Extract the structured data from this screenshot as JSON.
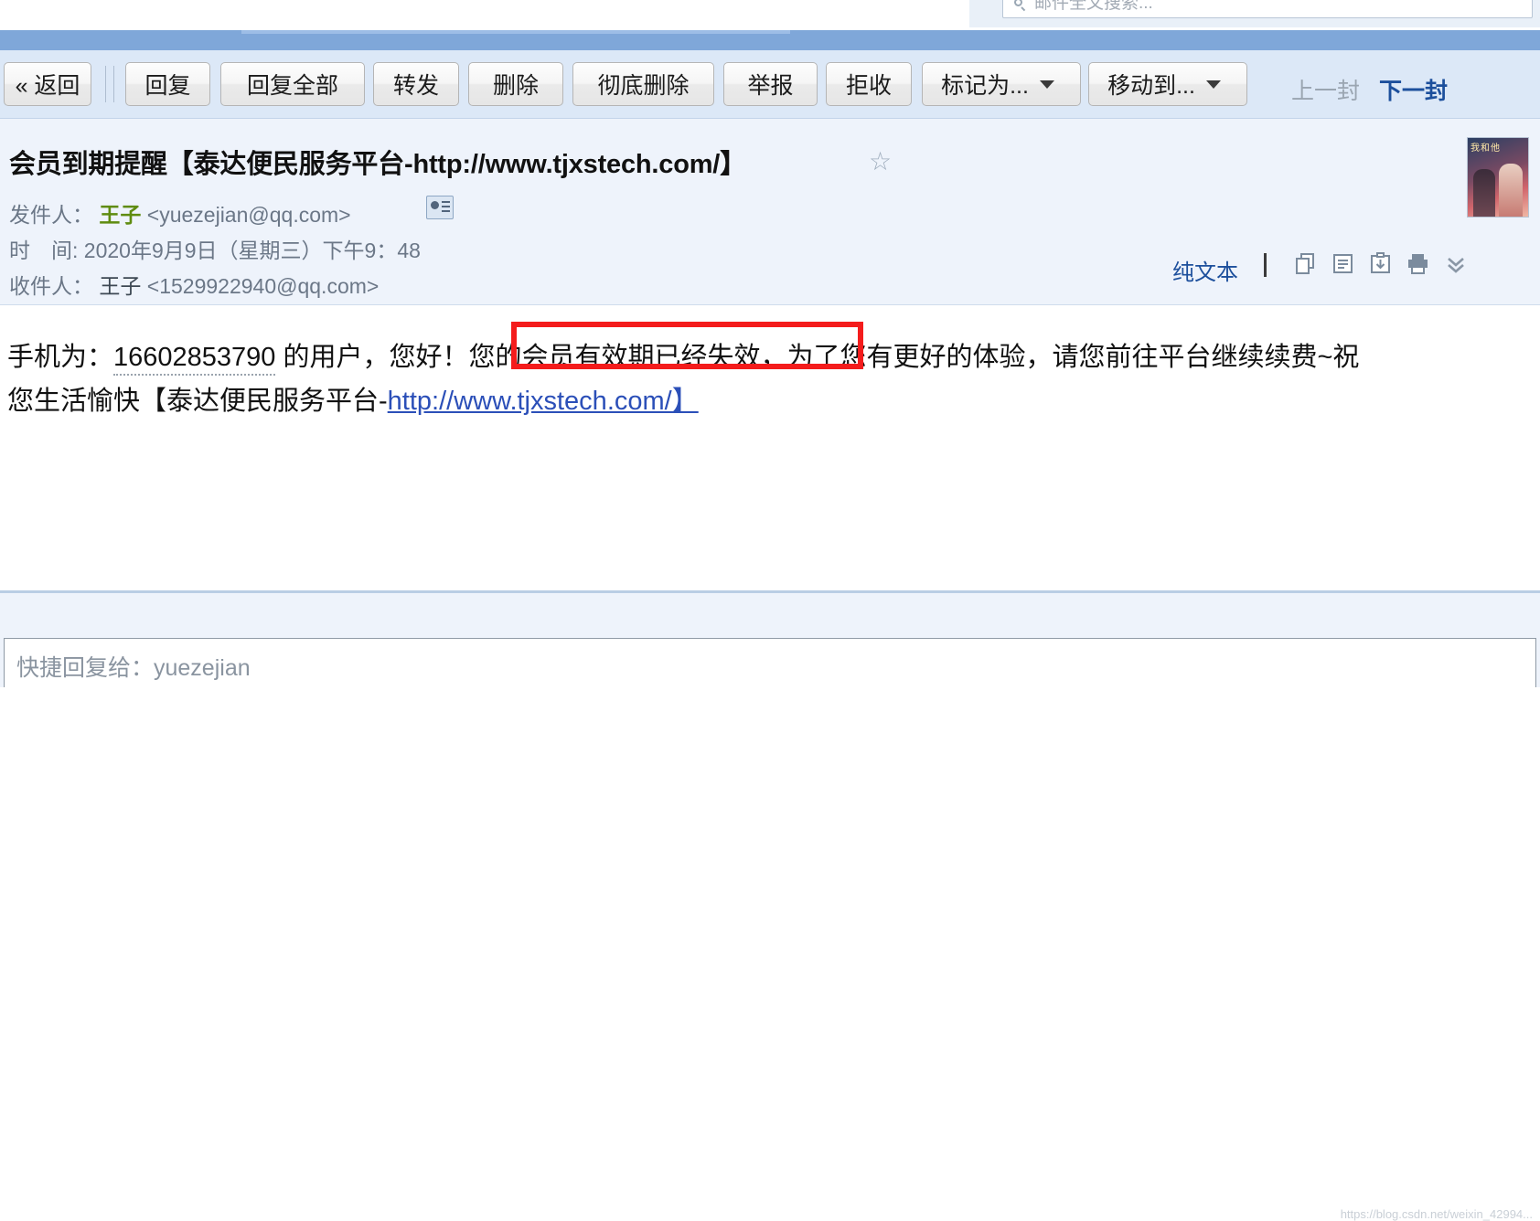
{
  "search": {
    "placeholder": "邮件全文搜索...",
    "icon": "search-icon"
  },
  "toolbar": {
    "back": "« 返回",
    "buttons": [
      {
        "label": "回复",
        "caret": false
      },
      {
        "label": "回复全部",
        "caret": false
      },
      {
        "label": "转发",
        "caret": false
      },
      {
        "label": "删除",
        "caret": false
      },
      {
        "label": "彻底删除",
        "caret": false
      },
      {
        "label": "举报",
        "caret": false
      },
      {
        "label": "拒收",
        "caret": false
      },
      {
        "label": "标记为...",
        "caret": true
      },
      {
        "label": "移动到...",
        "caret": true
      }
    ],
    "prev": "上一封",
    "next": "下一封"
  },
  "mail": {
    "subject": "会员到期提醒【泰达便民服务平台-http://www.tjxstech.com/】",
    "star_icon": "star-outline-icon",
    "from_label": "发件人：",
    "from_name": "王子",
    "from_address": "<yuezejian@qq.com>",
    "contact_icon": "contact-card-icon",
    "time_label": "时　间:",
    "time_value": "2020年9月9日（星期三）下午9：48",
    "to_label": "收件人：",
    "to_name": "王子",
    "to_address": "<1529922940@qq.com>",
    "view_mode": "纯文本",
    "tool_icons": [
      "copy-icon",
      "note-icon",
      "download-icon",
      "print-icon",
      "chevron-double-down-icon"
    ],
    "avatar_text": "我和他"
  },
  "body": {
    "line1_pre": "手机为：",
    "phone": "16602853790",
    "line1_mid": " 的用户，您好！",
    "line1_post": "您的会员有效期已经失效，为了您有更好的体验，请您前往平台继续续费~祝",
    "line2_pre": "您生活愉快【泰达便民服务平台-",
    "line2_link": "http://www.tjxstech.com/】",
    "highlight_color": "#f41c1c"
  },
  "bottom": {
    "quick_reply": "快捷回复给：yuezejian",
    "watermark": "https://blog.csdn.net/weixin_42994..."
  }
}
